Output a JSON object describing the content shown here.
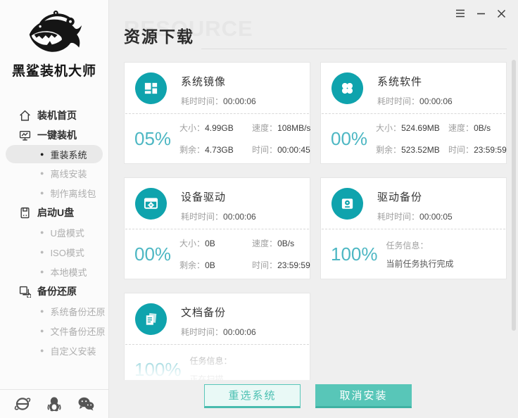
{
  "app_title": "黑鲨装机大师",
  "sidebar": {
    "logo_text": "黑鲨装机大师",
    "items": [
      {
        "label": "装机首页",
        "type": "parent",
        "icon": "home-icon"
      },
      {
        "label": "一键装机",
        "type": "parent",
        "icon": "one-key-monitor-icon"
      },
      {
        "label": "重装系统",
        "type": "sub",
        "active": true
      },
      {
        "label": "离线安装",
        "type": "sub"
      },
      {
        "label": "制作离线包",
        "type": "sub"
      },
      {
        "label": "启动U盘",
        "type": "parent",
        "icon": "usb-disk-icon"
      },
      {
        "label": "U盘模式",
        "type": "sub"
      },
      {
        "label": "ISO模式",
        "type": "sub"
      },
      {
        "label": "本地模式",
        "type": "sub"
      },
      {
        "label": "备份还原",
        "type": "parent",
        "icon": "backup-restore-icon"
      },
      {
        "label": "系统备份还原",
        "type": "sub"
      },
      {
        "label": "文件备份还原",
        "type": "sub"
      },
      {
        "label": "自定义安装",
        "type": "sub"
      }
    ],
    "footer_icons": [
      "ie",
      "qq",
      "wechat"
    ]
  },
  "window_controls": {
    "icons": [
      "menu",
      "minimize",
      "close"
    ]
  },
  "header": {
    "watermark": "RESOURCE",
    "title": "资源下载"
  },
  "labels": {
    "elapsed": "耗时时间：",
    "size": "大小：",
    "speed": "速度：",
    "remaining": "剩余：",
    "time": "时间：",
    "task_info": "任务信息："
  },
  "cards": [
    {
      "title": "系统镜像",
      "icon": "windows-icon",
      "elapsed": "00:00:06",
      "percent": "05%",
      "size": "4.99GB",
      "speed": "108MB/s",
      "remaining": "4.73GB",
      "time": "00:00:45"
    },
    {
      "title": "系统软件",
      "icon": "apps-icon",
      "elapsed": "00:00:06",
      "percent": "00%",
      "size": "524.69MB",
      "speed": "0B/s",
      "remaining": "523.52MB",
      "time": "23:59:59"
    },
    {
      "title": "设备驱动",
      "icon": "device-driver-icon",
      "elapsed": "00:00:06",
      "percent": "00%",
      "size": "0B",
      "speed": "0B/s",
      "remaining": "0B",
      "time": "23:59:59"
    },
    {
      "title": "驱动备份",
      "icon": "drive-backup-icon",
      "elapsed": "00:00:05",
      "percent": "100%",
      "task_status": "当前任务执行完成"
    },
    {
      "title": "文档备份",
      "icon": "document-icon",
      "elapsed": "00:00:06",
      "percent": "100%",
      "task_status": "正在扫描"
    }
  ],
  "buttons": {
    "reselect": "重选系统",
    "cancel": "取消安装"
  },
  "colors": {
    "icon_teal": "#0fa3ad",
    "percent_teal": "#4db7c3",
    "button_teal": "#58c6b8"
  }
}
